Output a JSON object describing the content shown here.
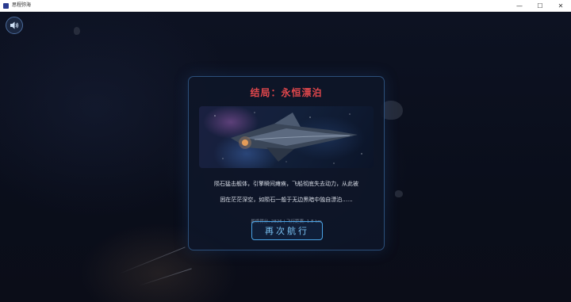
{
  "window": {
    "title": "思程弥海",
    "controls": {
      "minimize": "—",
      "maximize": "☐",
      "close": "✕"
    }
  },
  "game": {
    "sound_icon": "speaker-icon",
    "ending": {
      "title": "结局：永恒漂泊",
      "story_line1": "陨石猛击舰体，引擎瞬间瘫痪，飞船彻底失去动力，从此被",
      "story_line2": "困在茫茫深空，如陨石一般于无边黑暗中独自漂泊......",
      "stats": "最终得分: 2826 | 飞行距离: 1.8 km",
      "retry_label": "再次航行"
    },
    "colors": {
      "title": "#e0474c",
      "accent": "#4aa3e6",
      "panel_border": "#2c4f7a"
    }
  }
}
